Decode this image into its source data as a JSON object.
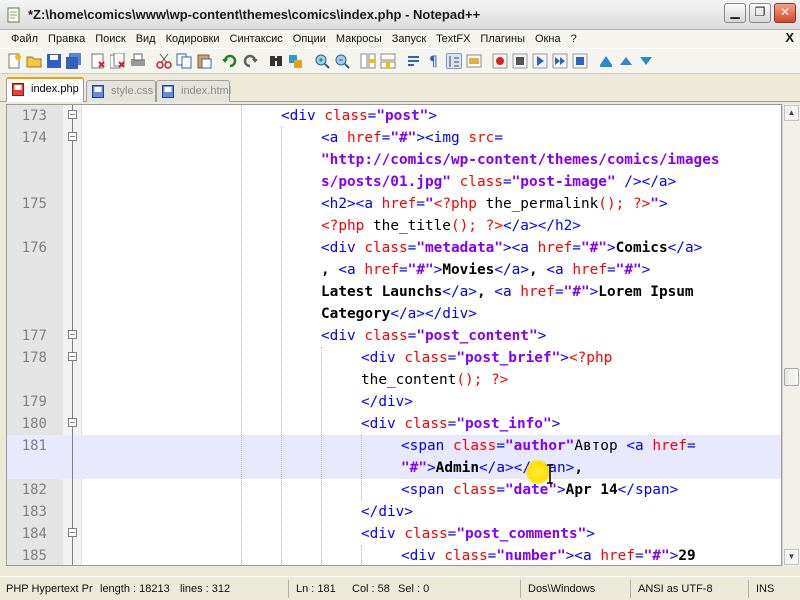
{
  "window": {
    "title": "*Z:\\home\\comics\\www\\wp-content\\themes\\comics\\index.php - Notepad++",
    "buttons": [
      "minimize",
      "maximize",
      "close"
    ]
  },
  "menu": {
    "items": [
      "Файл",
      "Правка",
      "Поиск",
      "Вид",
      "Кодировки",
      "Синтаксис",
      "Опции",
      "Макросы",
      "Запуск",
      "TextFX",
      "Плагины",
      "Окна",
      "?"
    ],
    "close_glyph": "X"
  },
  "toolbar": {
    "icons": [
      "new-icon",
      "open-icon",
      "save-icon",
      "save-all-icon",
      "close-icon",
      "close-all-icon",
      "print-icon",
      "cut-icon",
      "copy-icon",
      "paste-icon",
      "undo-icon",
      "redo-icon",
      "find-icon",
      "replace-icon",
      "zoom-in-icon",
      "zoom-out-icon",
      "sync-v-icon",
      "sync-h-icon",
      "wrap-icon",
      "all-chars-icon",
      "indent-guide-icon",
      "user-lang-icon",
      "record-icon",
      "stop-icon",
      "play-icon",
      "play-multi-icon",
      "save-macro-icon",
      "trim-icon",
      "up-icon",
      "down-icon"
    ]
  },
  "tabs": [
    {
      "label": "index.php",
      "active": true,
      "modified": true
    },
    {
      "label": "style.css",
      "active": false,
      "modified": false
    },
    {
      "label": "index.html",
      "active": false,
      "modified": false
    }
  ],
  "editor": {
    "current_line": 181
  },
  "status": {
    "filetype": "PHP Hypertext Pr",
    "length": "length : 18213",
    "lines": "lines : 312",
    "ln": "Ln : 181",
    "col": "Col : 58",
    "sel": "Sel : 0",
    "eol": "Dos\\Windows",
    "encoding": "ANSI as UTF-8",
    "mode": "INS"
  },
  "colors": {
    "tag": "#0000ff",
    "attribute": "#ff0000",
    "string": "#8000ff",
    "php": "#ff0000",
    "current_line_bg": "#e8e8ff",
    "active_tab_accent": "#f6a000"
  }
}
